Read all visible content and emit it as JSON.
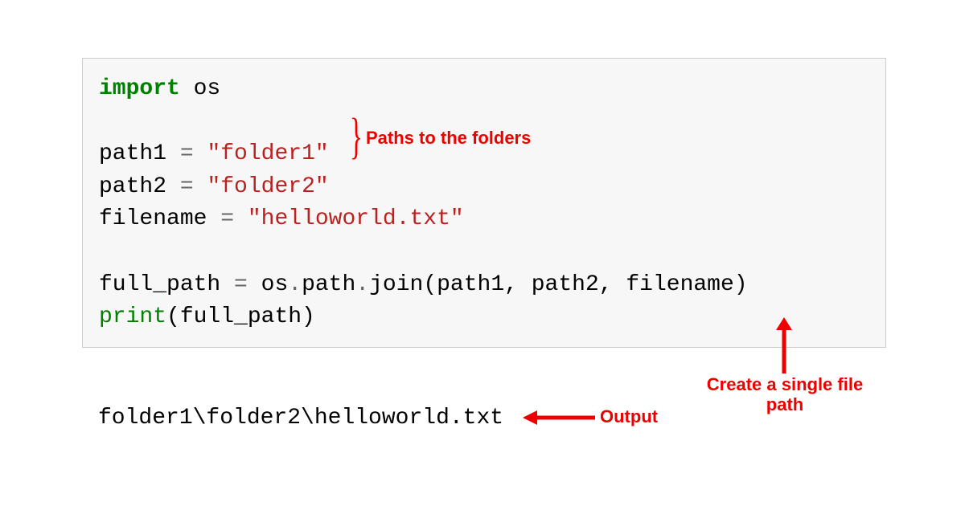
{
  "code": {
    "line1_kw": "import",
    "line1_mod": " os",
    "line3_var": "path1 ",
    "line3_op": "=",
    "line3_str": " \"folder1\"",
    "line4_var": "path2 ",
    "line4_op": "=",
    "line4_str": " \"folder2\"",
    "line5_var": "filename ",
    "line5_op": "=",
    "line5_str": " \"helloworld.txt\"",
    "line7_var": "full_path ",
    "line7_op": "=",
    "line7_expr": " os",
    "line7_dot1": ".",
    "line7_path": "path",
    "line7_dot2": ".",
    "line7_join": "join(path1, path2, filename)",
    "line8_fn": "print",
    "line8_args": "(full_path)"
  },
  "output": "folder1\\folder2\\helloworld.txt",
  "annotations": {
    "paths": "Paths to the folders",
    "create": "Create a single file path",
    "output": "Output"
  }
}
